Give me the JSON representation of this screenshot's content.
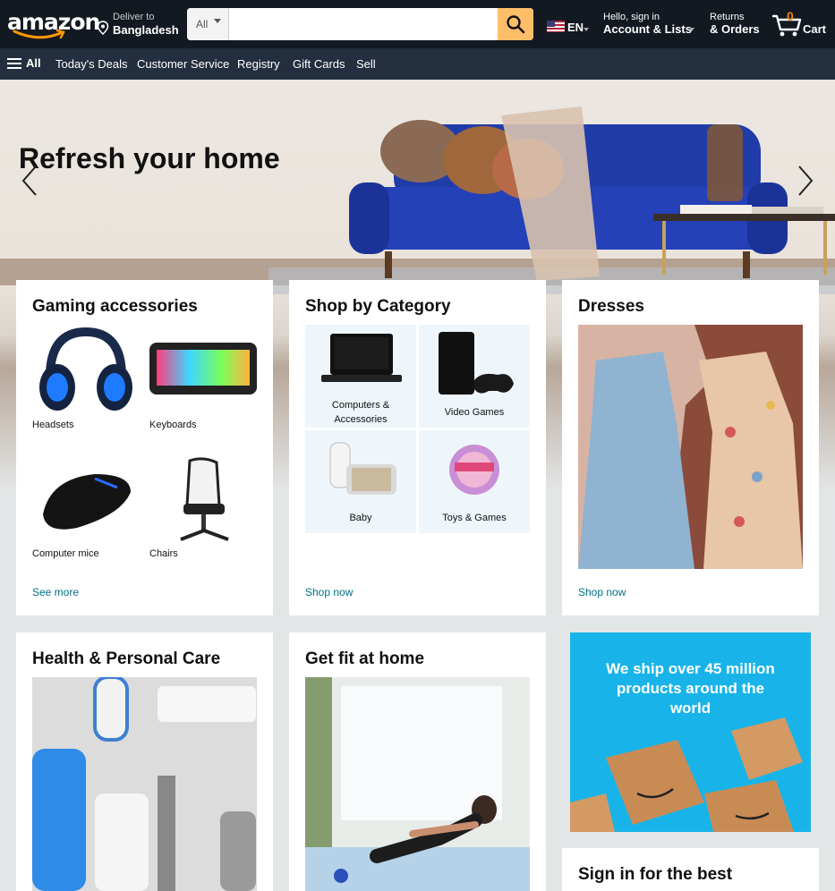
{
  "header": {
    "logo_text": "amazon",
    "deliver_line1": "Deliver to",
    "deliver_line2": "Bangladesh",
    "search_category": "All",
    "search_placeholder": "",
    "lang": "EN",
    "account_line1": "Hello, sign in",
    "account_line2": "Account & Lists",
    "returns_line1": "Returns",
    "returns_line2": "& Orders",
    "cart_count": "0",
    "cart_label": "Cart",
    "accent_color": "#febd69"
  },
  "subnav": {
    "all_label": "All",
    "links": [
      "Today's Deals",
      "Customer Service",
      "Registry",
      "Gift Cards",
      "Sell"
    ]
  },
  "hero": {
    "title": "Refresh your home"
  },
  "cards": {
    "gaming": {
      "title": "Gaming accessories",
      "items": [
        "Headsets",
        "Keyboards",
        "Computer mice",
        "Chairs"
      ],
      "link": "See more"
    },
    "category": {
      "title": "Shop by Category",
      "items": [
        "Computers & Accessories",
        "Video Games",
        "Baby",
        "Toys & Games"
      ],
      "link": "Shop now"
    },
    "dresses": {
      "title": "Dresses",
      "link": "Shop now"
    },
    "health": {
      "title": "Health & Personal Care"
    },
    "fit": {
      "title": "Get fit at home"
    },
    "promo": {
      "text": "We ship over 45 million products around the world"
    },
    "signin": {
      "title": "Sign in for the best"
    }
  }
}
